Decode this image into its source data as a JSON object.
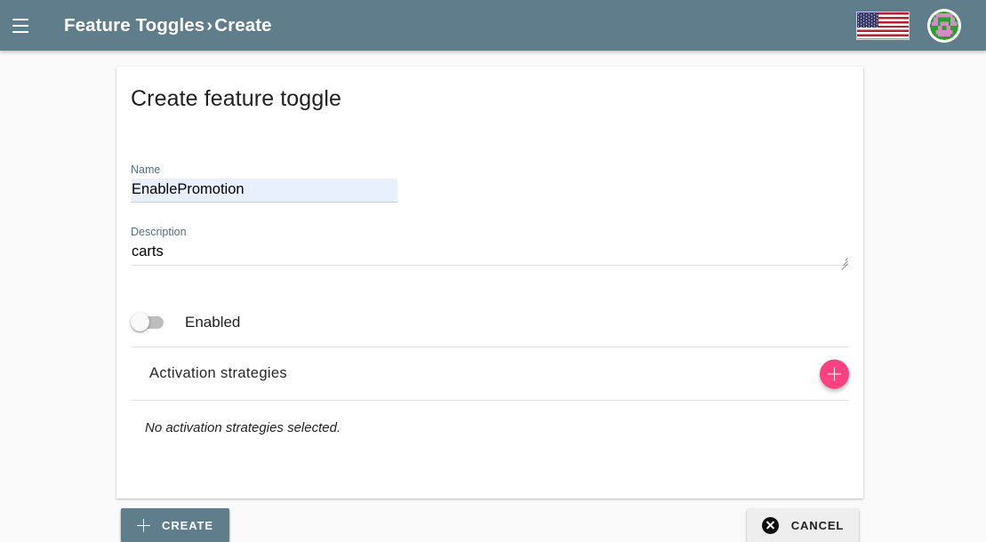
{
  "appbar": {
    "menu_icon": "hamburger-menu-icon",
    "breadcrumb_root": "Feature Toggles",
    "breadcrumb_separator": "›",
    "breadcrumb_current": "Create",
    "flag_icon": "us-flag-icon",
    "avatar_icon": "user-avatar-identicon",
    "bar_color": "#607d8b"
  },
  "card": {
    "title": "Create feature toggle",
    "name_field": {
      "label": "Name",
      "value": "EnablePromotion",
      "placeholder": "",
      "background_color": "#e8f0fe"
    },
    "description_field": {
      "label": "Description",
      "value": "carts",
      "placeholder": ""
    },
    "enabled_toggle": {
      "label": "Enabled",
      "state": "off"
    },
    "strategies": {
      "title": "Activation strategies",
      "add_button_icon": "plus-icon",
      "add_button_color": "#ff4081",
      "empty_message": "No activation strategies selected."
    }
  },
  "footer": {
    "create_label": "CREATE",
    "create_icon": "plus-icon",
    "create_color": "#607d8b",
    "cancel_label": "CANCEL",
    "cancel_icon": "close-circle-icon",
    "cancel_color": "#eeeeee"
  }
}
